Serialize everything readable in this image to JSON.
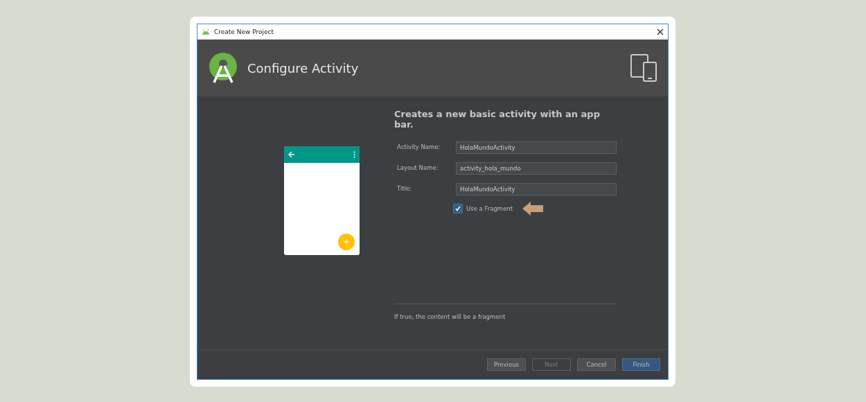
{
  "window": {
    "title": "Create New Project"
  },
  "header": {
    "title": "Configure Activity"
  },
  "description": "Creates a new basic activity with an app bar.",
  "fields": [
    {
      "label": "Activity Name:",
      "value": "HolaMundoActivity"
    },
    {
      "label": "Layout Name:",
      "value": "activity_hola_mundo"
    },
    {
      "label": "Title:",
      "value": "HolaMundoActivity"
    }
  ],
  "checkbox": {
    "label": "Use a Fragment",
    "checked": true
  },
  "hint": "If true, the content will be a fragment",
  "buttons": [
    {
      "label": "Previous",
      "kind": "secondary",
      "disabled": false
    },
    {
      "label": "Next",
      "kind": "secondary",
      "disabled": true
    },
    {
      "label": "Cancel",
      "kind": "secondary",
      "disabled": false
    },
    {
      "label": "Finish",
      "kind": "primary",
      "disabled": false
    }
  ]
}
